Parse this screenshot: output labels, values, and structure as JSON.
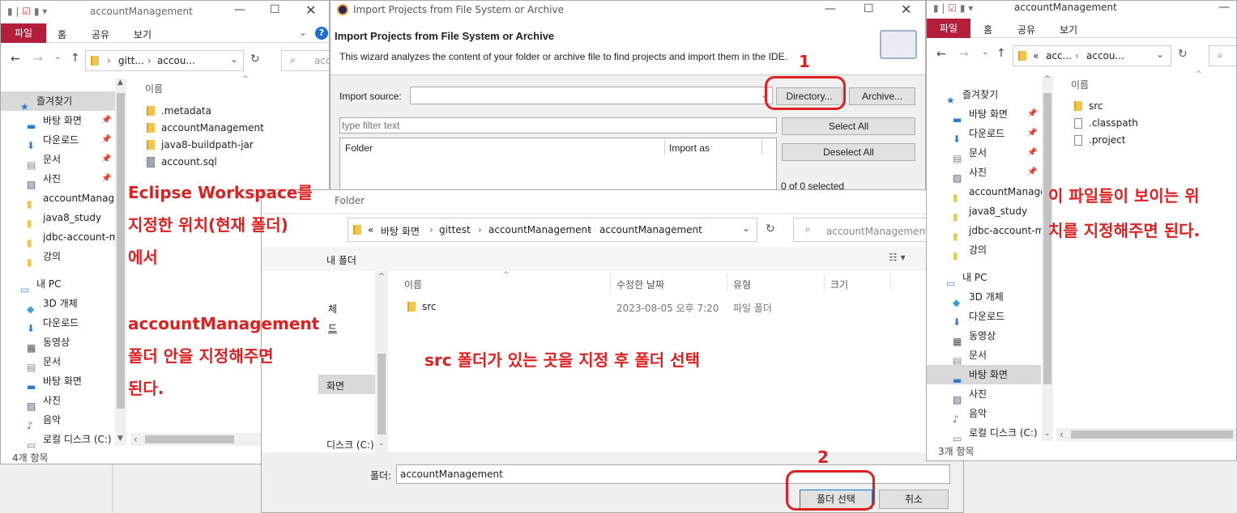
{
  "left_explorer": {
    "title": "accountManagement",
    "ribbon_tabs": [
      "파일",
      "홈",
      "공유",
      "보기"
    ],
    "path": [
      "gitt...",
      "accou..."
    ],
    "search_placeholder": "acco",
    "column_name": "이름",
    "nav": [
      {
        "label": "즐겨찾기",
        "icon": "star-icon"
      },
      {
        "label": "바탕 화면",
        "icon": "desktop-icon",
        "pinned": true
      },
      {
        "label": "다운로드",
        "icon": "download-icon",
        "pinned": true
      },
      {
        "label": "문서",
        "icon": "document-icon",
        "pinned": true
      },
      {
        "label": "사진",
        "icon": "picture-icon",
        "pinned": true
      },
      {
        "label": "accountManage",
        "icon": "folder-icon"
      },
      {
        "label": "java8_study",
        "icon": "folder-icon"
      },
      {
        "label": "jdbc-account-m",
        "icon": "folder-icon"
      },
      {
        "label": "강의",
        "icon": "folder-icon"
      },
      {
        "label": "내 PC",
        "icon": "pc-icon"
      },
      {
        "label": "3D 개체",
        "icon": "cube-icon"
      },
      {
        "label": "다운로드",
        "icon": "download-icon"
      },
      {
        "label": "동영상",
        "icon": "video-icon"
      },
      {
        "label": "문서",
        "icon": "document-icon"
      },
      {
        "label": "바탕 화면",
        "icon": "desktop-icon"
      },
      {
        "label": "사진",
        "icon": "picture-icon"
      },
      {
        "label": "음악",
        "icon": "music-icon"
      },
      {
        "label": "로컬 디스크 (C:)",
        "icon": "disk-icon"
      }
    ],
    "files": [
      {
        "name": ".metadata",
        "icon": "folder-icon"
      },
      {
        "name": "accountManagement",
        "icon": "folder-icon"
      },
      {
        "name": "java8-buildpath-jar",
        "icon": "folder-icon"
      },
      {
        "name": "account.sql",
        "icon": "sql-file-icon"
      }
    ],
    "status": "4개 항목"
  },
  "eclipse_dialog": {
    "window_title": "Import Projects from File System or Archive",
    "heading": "Import Projects from File System or Archive",
    "description": "This wizard analyzes the content of your folder or archive file to find projects and import them in the IDE.",
    "import_source_label": "Import source:",
    "import_source_value": "",
    "directory_button": "Directory...",
    "archive_button": "Archive...",
    "filter_placeholder": "type filter text",
    "col_folder": "Folder",
    "col_import_as": "Import as",
    "select_all": "Select All",
    "deselect_all": "Deselect All",
    "selected_count": "0 of 0 selected"
  },
  "folder_dialog": {
    "title": "Folder",
    "path": [
      "«",
      "바탕 화면",
      "gittest",
      "accountManagement",
      "accountManagement"
    ],
    "search_placeholder": "accountManagement 검",
    "new_folder": "내 폴더",
    "columns": [
      "이름",
      "수정한 날짜",
      "유형",
      "크기"
    ],
    "rows": [
      {
        "name": "src",
        "date": "2023-08-05 오후 7:20",
        "type": "파일 폴더",
        "size": ""
      }
    ],
    "nav_partial": [
      "체",
      "드",
      "",
      "화면",
      "",
      "디스크 (C:)"
    ],
    "folder_label": "폴더:",
    "folder_value": "accountManagement",
    "select_button": "폴더 선택",
    "cancel_button": "취소"
  },
  "right_explorer": {
    "title": "accountManagement",
    "ribbon_tabs": [
      "파일",
      "홈",
      "공유",
      "보기"
    ],
    "path": [
      "«",
      "acc...",
      "accou..."
    ],
    "column_name": "이름",
    "nav": [
      {
        "label": "즐겨찾기",
        "icon": "star-icon"
      },
      {
        "label": "바탕 화면",
        "icon": "desktop-icon",
        "pinned": true
      },
      {
        "label": "다운로드",
        "icon": "download-icon",
        "pinned": true
      },
      {
        "label": "문서",
        "icon": "document-icon",
        "pinned": true
      },
      {
        "label": "사진",
        "icon": "picture-icon",
        "pinned": true
      },
      {
        "label": "accountManage",
        "icon": "folder-icon"
      },
      {
        "label": "java8_study",
        "icon": "folder-icon"
      },
      {
        "label": "jdbc-account-m",
        "icon": "folder-icon"
      },
      {
        "label": "강의",
        "icon": "folder-icon"
      },
      {
        "label": "내 PC",
        "icon": "pc-icon"
      },
      {
        "label": "3D 개체",
        "icon": "cube-icon"
      },
      {
        "label": "다운로드",
        "icon": "download-icon"
      },
      {
        "label": "동영상",
        "icon": "video-icon"
      },
      {
        "label": "문서",
        "icon": "document-icon"
      },
      {
        "label": "바탕 화면",
        "icon": "desktop-icon"
      },
      {
        "label": "사진",
        "icon": "picture-icon"
      },
      {
        "label": "음악",
        "icon": "music-icon"
      },
      {
        "label": "로컬 디스크 (C:)",
        "icon": "disk-icon"
      }
    ],
    "files": [
      {
        "name": "src",
        "icon": "folder-icon"
      },
      {
        "name": ".classpath",
        "icon": "file-icon"
      },
      {
        "name": ".project",
        "icon": "file-icon"
      }
    ],
    "status": "3개 항목"
  },
  "annotations": {
    "step1": "1",
    "step2": "2",
    "left_note": [
      "Eclipse Workspace를",
      "지정한 위치(현재 폴더)",
      "에서",
      "",
      "accountManagement",
      "폴더 안을 지정해주면",
      "된다."
    ],
    "center_note": "src 폴더가 있는 곳을 지정 후 폴더 선택",
    "right_note": [
      "이 파일들이 보이는 위",
      "치를 지정해주면 된다."
    ]
  },
  "colors": {
    "ribbon_file": "#b41e3c",
    "annotation": "#e02020",
    "selection": "#cce8ff"
  }
}
